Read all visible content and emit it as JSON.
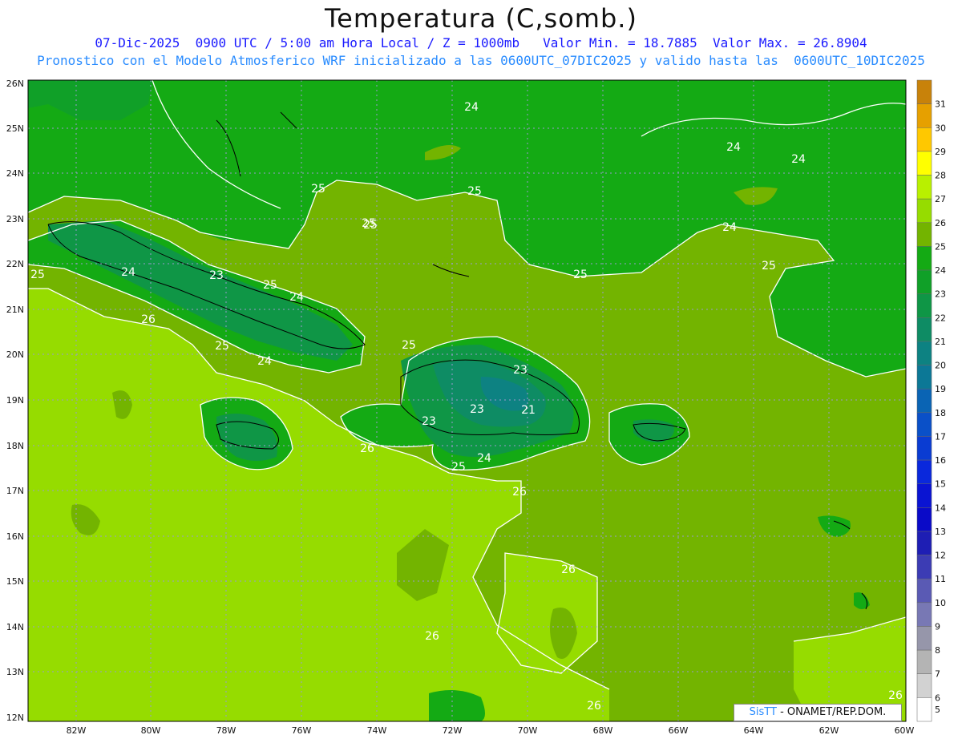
{
  "header": {
    "title": "Temperatura (C,somb.)",
    "line1": "07-Dic-2025  0900 UTC / 5:00 am Hora Local / Z = 1000mb   Valor Min. = 18.7885  Valor Max. = 26.8904",
    "line2": "Pronostico con el Modelo Atmosferico WRF inicializado a las 0600UTC_07DIC2025 y valido hasta las  0600UTC_10DIC2025"
  },
  "axes": {
    "lon_labels": [
      "82W",
      "80W",
      "78W",
      "76W",
      "74W",
      "72W",
      "70W",
      "68W",
      "66W",
      "64W",
      "62W",
      "60W"
    ],
    "lat_labels": [
      "26N",
      "25N",
      "24N",
      "23N",
      "22N",
      "21N",
      "20N",
      "19N",
      "18N",
      "17N",
      "16N",
      "15N",
      "14N",
      "13N",
      "12N"
    ]
  },
  "colorbar": {
    "levels": [
      "31",
      "30",
      "29",
      "28",
      "27",
      "26",
      "25",
      "24",
      "23",
      "22",
      "21",
      "20",
      "19",
      "18",
      "17",
      "16",
      "15",
      "14",
      "13",
      "12",
      "11",
      "10",
      "9",
      "8",
      "7",
      "6",
      "5"
    ],
    "colors": [
      "#c8820a",
      "#e6a000",
      "#ffc800",
      "#ffff00",
      "#b9f000",
      "#96dc00",
      "#73b400",
      "#14aa14",
      "#10a028",
      "#0f9646",
      "#0e8c64",
      "#0d8282",
      "#0c7896",
      "#0a64b4",
      "#0a50c8",
      "#0a3cd2",
      "#0a28dc",
      "#0a14d2",
      "#0a0ac8",
      "#1e1eb4",
      "#3c3cb4",
      "#5a5ab4",
      "#7878b4",
      "#9696aa",
      "#b4b4b4",
      "#d2d2d2",
      "#ffffff"
    ]
  },
  "map": {
    "contour_labels": [
      "24",
      "24",
      "24",
      "24",
      "25",
      "25",
      "25",
      "25",
      "25",
      "25",
      "25",
      "26",
      "25",
      "24",
      "23",
      "25",
      "24",
      "25",
      "23",
      "24",
      "23",
      "23",
      "21",
      "26",
      "24",
      "26",
      "26",
      "26",
      "26",
      "25",
      "26"
    ]
  },
  "credit": {
    "brand": "SisTT",
    "text": "- ONAMET/REP.DOM."
  }
}
